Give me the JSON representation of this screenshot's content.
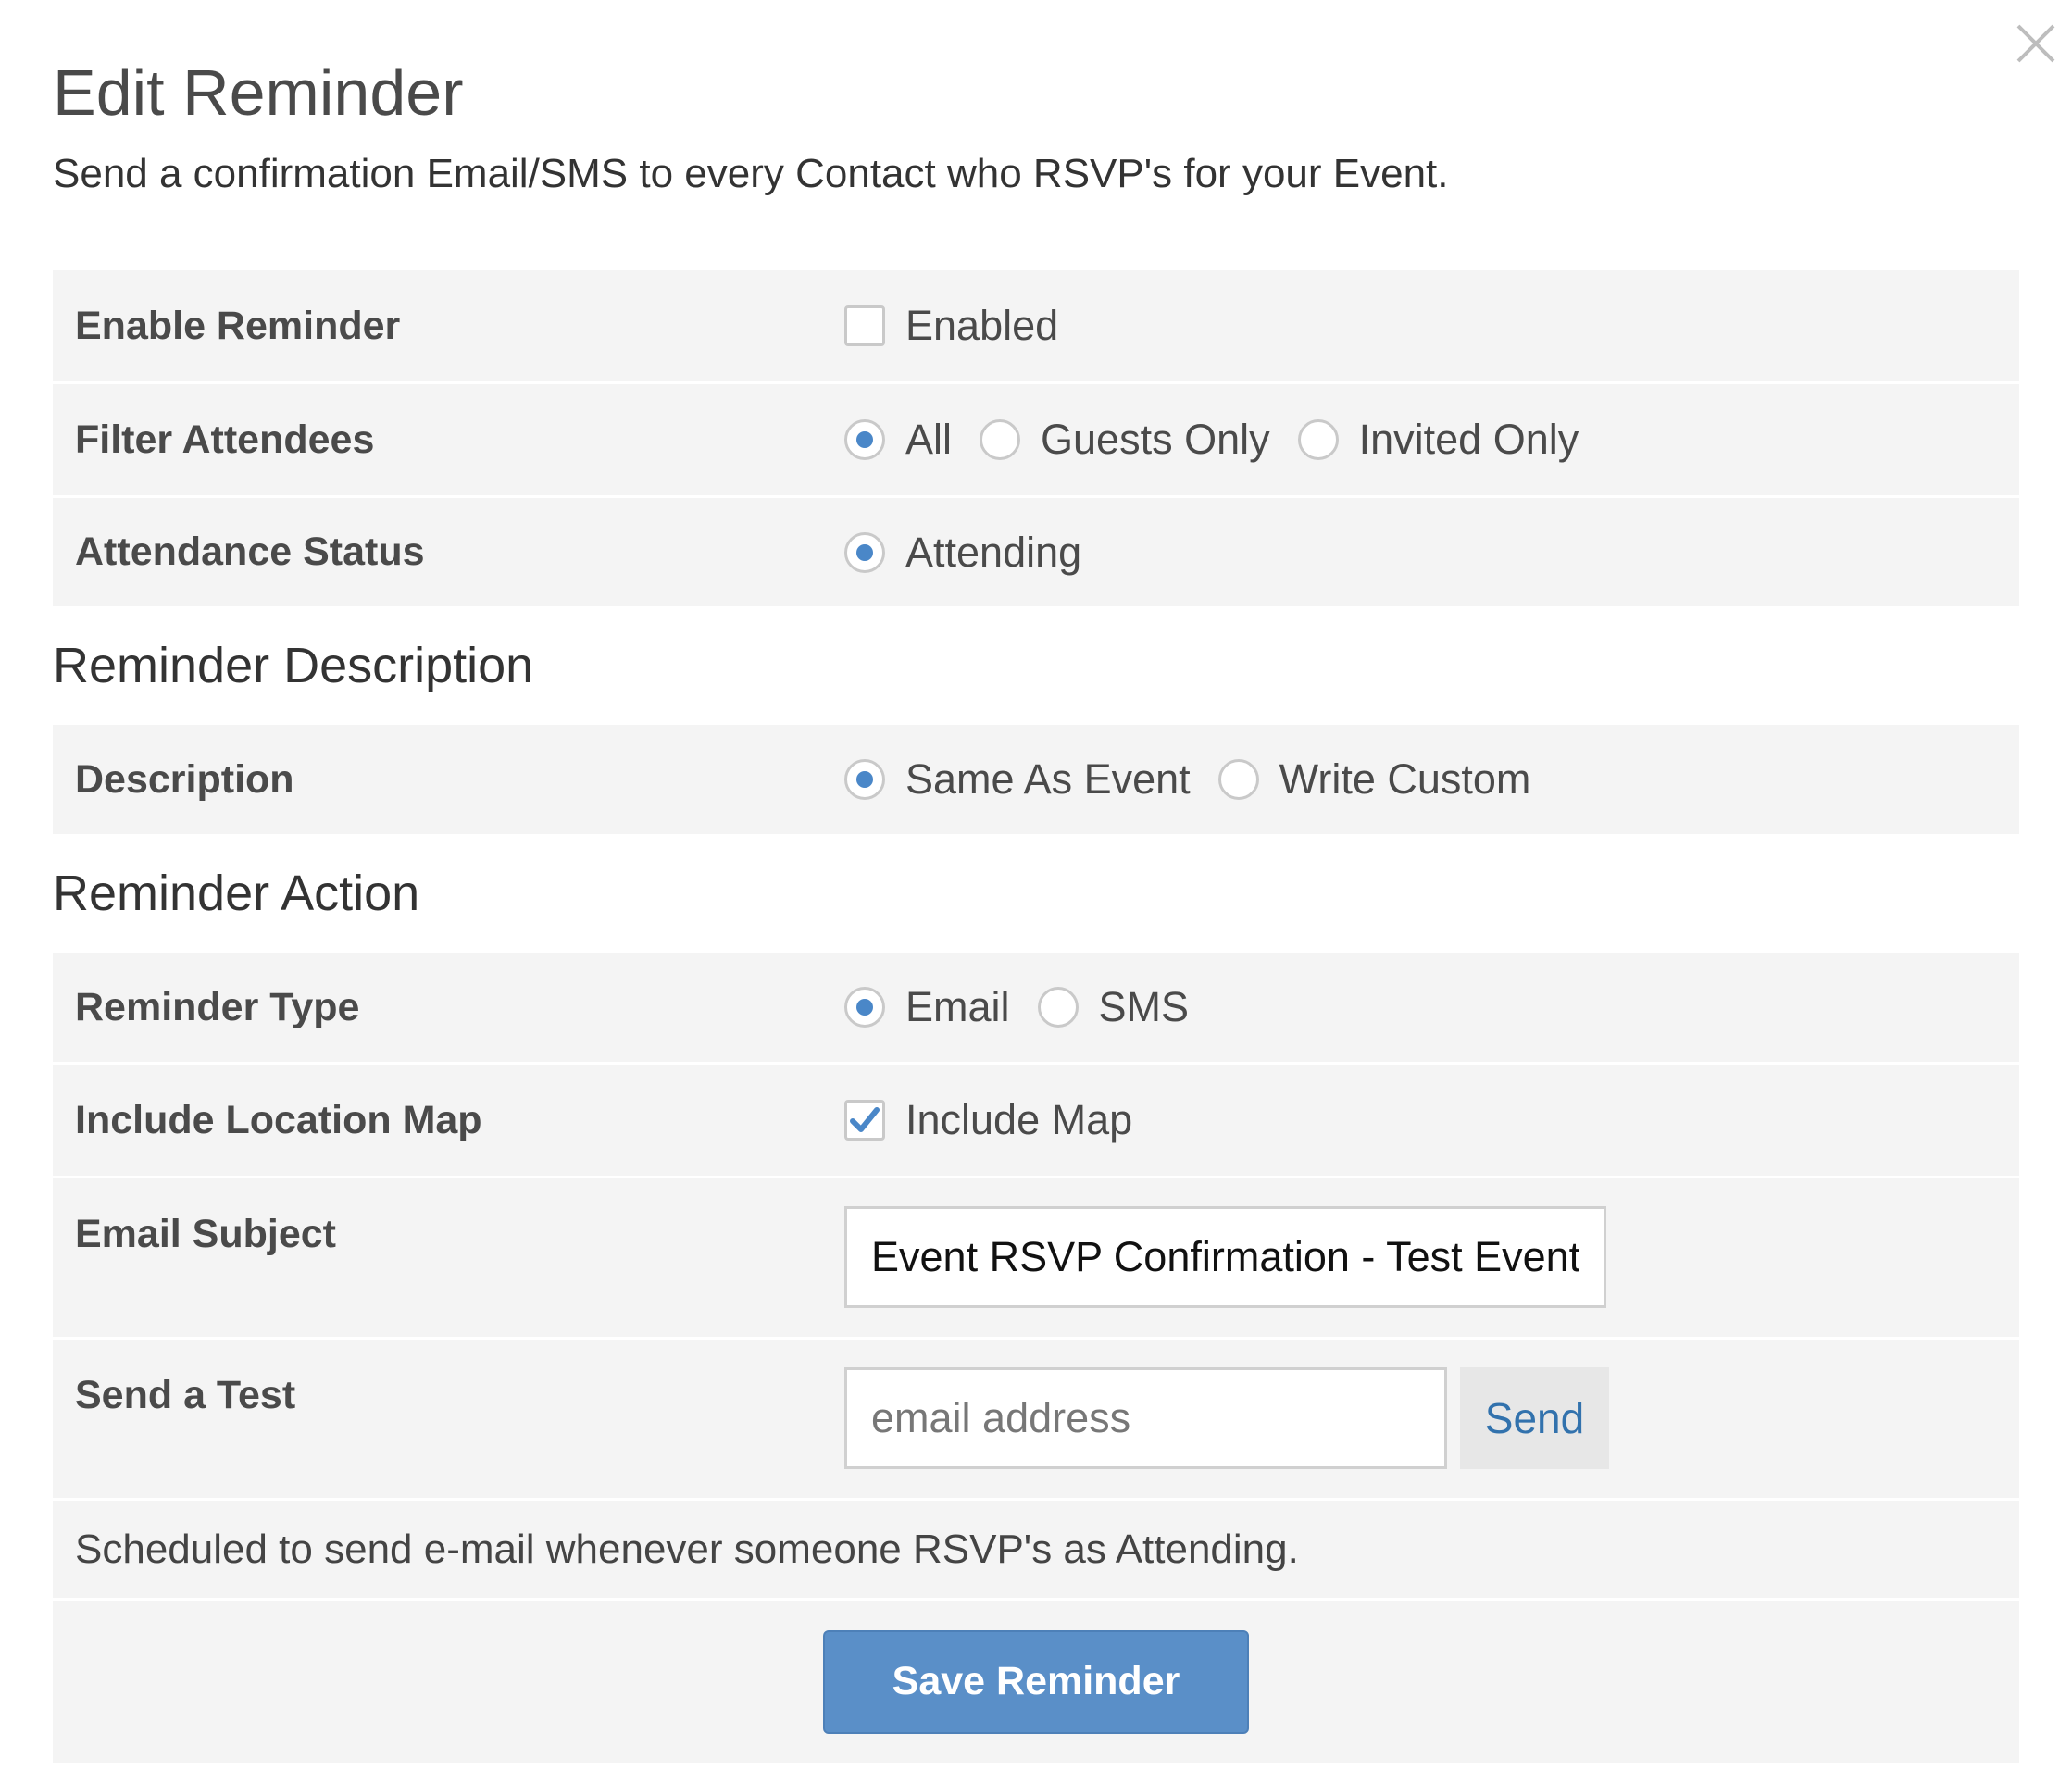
{
  "header": {
    "title": "Edit Reminder",
    "subtitle": "Send a confirmation Email/SMS to every Contact who RSVP's for your Event."
  },
  "settings": {
    "enable_reminder": {
      "label": "Enable Reminder",
      "option": "Enabled",
      "checked": false
    },
    "filter_attendees": {
      "label": "Filter Attendees",
      "options": [
        "All",
        "Guests Only",
        "Invited Only"
      ],
      "selected": "All"
    },
    "attendance_status": {
      "label": "Attendance Status",
      "options": [
        "Attending"
      ],
      "selected": "Attending"
    }
  },
  "description_section": {
    "title": "Reminder Description",
    "description": {
      "label": "Description",
      "options": [
        "Same As Event",
        "Write Custom"
      ],
      "selected": "Same As Event"
    }
  },
  "action_section": {
    "title": "Reminder Action",
    "reminder_type": {
      "label": "Reminder Type",
      "options": [
        "Email",
        "SMS"
      ],
      "selected": "Email"
    },
    "location_map": {
      "label": "Include Location Map",
      "option": "Include Map",
      "checked": true
    },
    "email_subject": {
      "label": "Email Subject",
      "value": "Event RSVP Confirmation - Test Event"
    },
    "send_test": {
      "label": "Send a Test",
      "placeholder": "email address",
      "button": "Send"
    }
  },
  "footer": {
    "note": "Scheduled to send e-mail whenever someone RSVP's as Attending.",
    "save_label": "Save Reminder"
  },
  "colors": {
    "accent": "#4a87c8",
    "primary_button": "#5a8fc8",
    "link": "#3272ad",
    "panel": "#f4f4f4"
  }
}
